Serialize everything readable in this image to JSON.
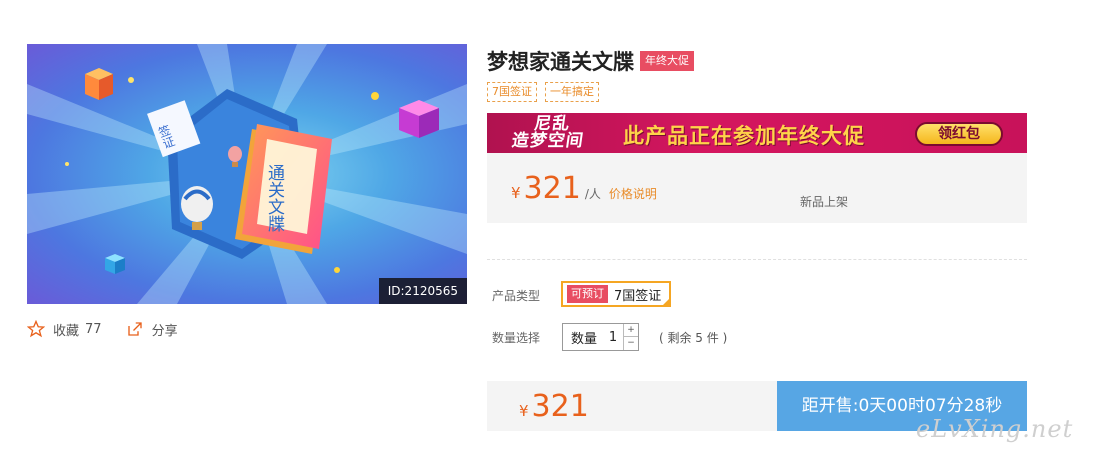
{
  "product": {
    "title": "梦想家通关文牒",
    "promo_badge": "年终大促",
    "tags": [
      "7国签证",
      "一年搞定"
    ],
    "image": {
      "book_title": "通关文牒",
      "ticket_text": "签证",
      "id_label": "ID:2120565"
    }
  },
  "actions": {
    "favorite_label": "收藏",
    "favorite_count": "77",
    "share_label": "分享"
  },
  "banner": {
    "logo_line1": "尼乱",
    "logo_line2": "造梦空间",
    "text": "此产品正在参加年终大促",
    "button_label": "领红包"
  },
  "price": {
    "currency": "¥",
    "amount": "321",
    "unit": "/人",
    "note": "价格说明",
    "new_label": "新品上架"
  },
  "options": {
    "type_label": "产品类型",
    "type_sub_badge": "可预订",
    "type_value": "7国签证",
    "qty_label_row": "数量选择",
    "qty_field_label": "数量",
    "qty_value": "1",
    "plus": "+",
    "minus": "−",
    "stock_text": "( 剩余 5 件 )"
  },
  "buy": {
    "currency": "¥",
    "amount": "321",
    "countdown": "距开售:0天00时07分28秒"
  },
  "watermark": "eLvXing.net",
  "colors": {
    "accent_orange": "#e8611c",
    "badge_red": "#e84d62",
    "countdown_blue": "#57a6e4",
    "option_border": "#f5a623"
  }
}
